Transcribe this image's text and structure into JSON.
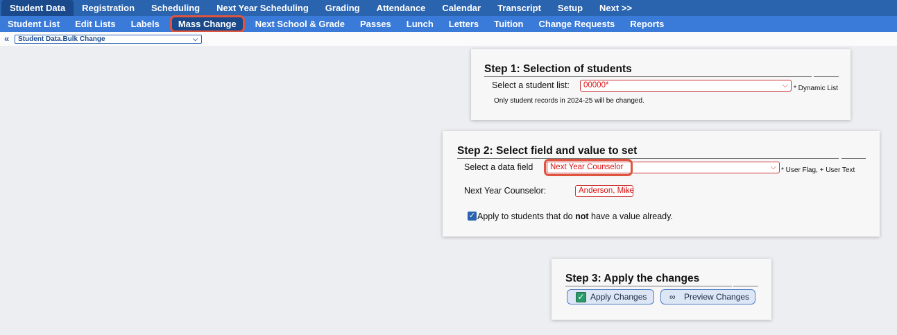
{
  "top_nav": [
    "Student Data",
    "Registration",
    "Scheduling",
    "Next Year Scheduling",
    "Grading",
    "Attendance",
    "Calendar",
    "Transcript",
    "Setup",
    "Next >>"
  ],
  "sub_nav": [
    "Student List",
    "Edit Lists",
    "Labels",
    "Mass Change",
    "Next School & Grade",
    "Passes",
    "Lunch",
    "Letters",
    "Tuition",
    "Change Requests",
    "Reports"
  ],
  "breadcrumb": {
    "back": "«",
    "value": "Student Data.Bulk Change"
  },
  "step1": {
    "title": "Step 1: Selection of students",
    "label": "Select a student list:",
    "value": "00000*",
    "suffix": "* Dynamic List",
    "note": "Only student records in 2024-25 will be changed."
  },
  "step2": {
    "title": "Step 2: Select field and value to set",
    "field_label": "Select a data field",
    "field_value": "Next Year Counselor",
    "field_suffix": "* User Flag, + User Text",
    "value_label": "Next Year Counselor:",
    "value_value": "Anderson, Mike",
    "apply_pre": "Apply to students that do ",
    "apply_bold": "not",
    "apply_post": " have a value already.",
    "apply_checked": true
  },
  "step3": {
    "title": "Step 3: Apply the changes",
    "apply_button": "Apply Changes",
    "preview_button": "Preview Changes"
  },
  "icons": {
    "check": "check-icon",
    "binoculars": "binoculars-icon",
    "chevron": "chevron-down-icon"
  },
  "colors": {
    "nav_top": "#2a63ae",
    "nav_sub": "#3a7ad8",
    "highlight": "#e0533c",
    "select_text": "#dd1111"
  }
}
